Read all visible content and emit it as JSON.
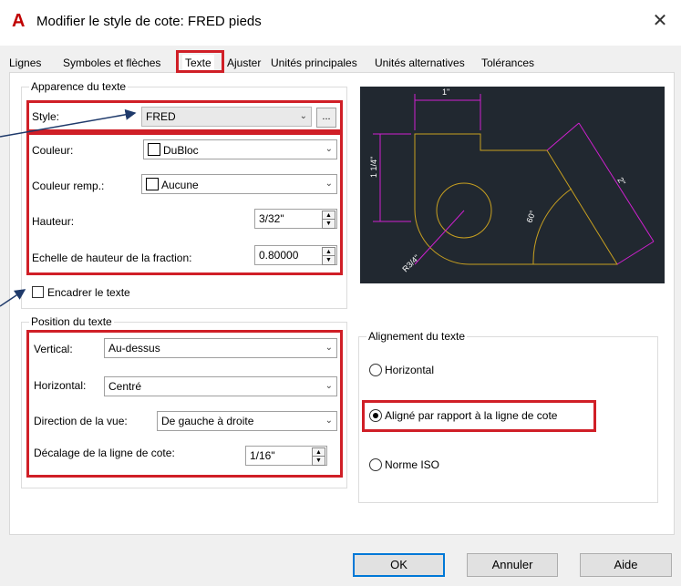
{
  "window": {
    "title": "Modifier le style de cote: FRED pieds",
    "app_icon": "A",
    "close": "✕"
  },
  "tabs": [
    {
      "label": "Lignes"
    },
    {
      "label": "Symboles et flèches"
    },
    {
      "label": "Texte"
    },
    {
      "label": "Ajuster"
    },
    {
      "label": "Unités principales"
    },
    {
      "label": "Unités alternatives"
    },
    {
      "label": "Tolérances"
    }
  ],
  "appearance": {
    "legend": "Apparence du texte",
    "style_label": "Style:",
    "style_value": "FRED",
    "style_btn": "...",
    "color_label": "Couleur:",
    "color_value": "DuBloc",
    "fill_label": "Couleur remp.:",
    "fill_value": "Aucune",
    "height_label": "Hauteur:",
    "height_value": "3/32\"",
    "fraction_label": "Echelle de hauteur de la fraction:",
    "fraction_value": "0.80000",
    "frame_label": "Encadrer le texte",
    "frame_checked": false
  },
  "position": {
    "legend": "Position du texte",
    "vertical_label": "Vertical:",
    "vertical_value": "Au-dessus",
    "horizontal_label": "Horizontal:",
    "horizontal_value": "Centré",
    "direction_label": "Direction de la vue:",
    "direction_value": "De gauche à droite",
    "offset_label": "Décalage de la ligne de cote:",
    "offset_value": "1/16\""
  },
  "alignment": {
    "legend": "Alignement du texte",
    "options": [
      {
        "label": "Horizontal",
        "selected": false
      },
      {
        "label": "Aligné par rapport à la ligne de cote",
        "selected": true
      },
      {
        "label": "Norme ISO",
        "selected": false
      }
    ]
  },
  "preview": {
    "dim_top": "1\"",
    "dim_left": "1 1/4\"",
    "dim_right": "2\"",
    "dim_angle": "60°",
    "dim_radius": "R3/4\""
  },
  "buttons": {
    "ok": "OK",
    "cancel": "Annuler",
    "help": "Aide"
  },
  "colors": {
    "highlight": "#d01f27",
    "preview_bg": "#212830",
    "geometry": "#c8a020",
    "dimension": "#d020d0"
  }
}
